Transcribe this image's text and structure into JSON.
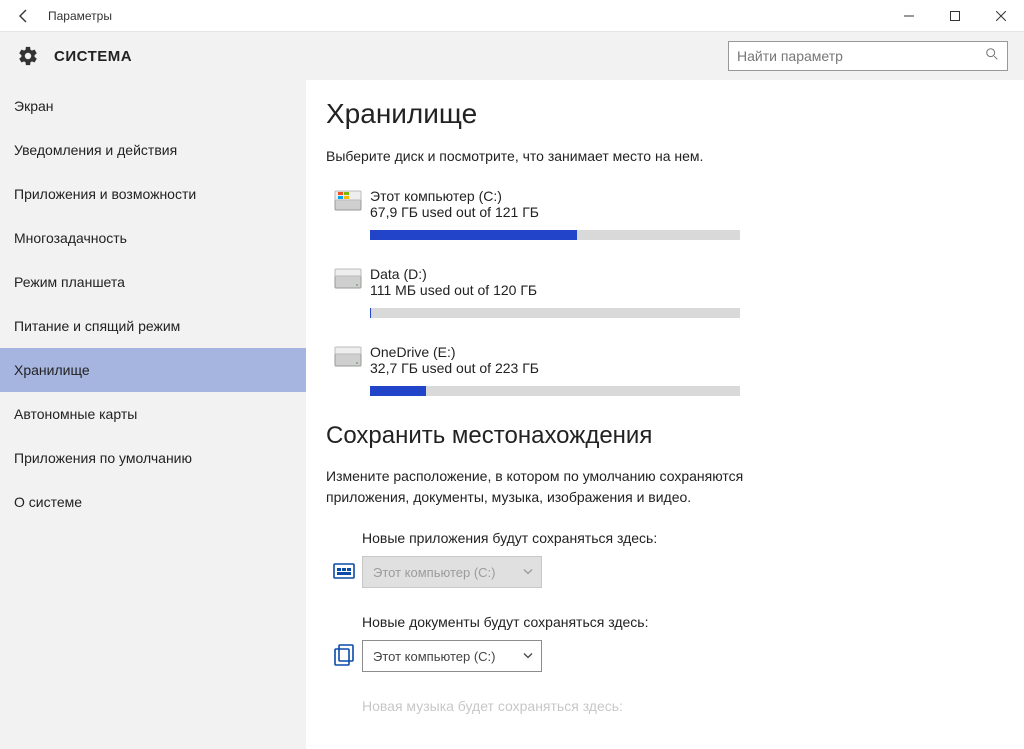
{
  "window": {
    "title": "Параметры"
  },
  "header": {
    "section": "СИСТЕМА",
    "search_placeholder": "Найти параметр"
  },
  "sidebar": {
    "items": [
      {
        "label": "Экран"
      },
      {
        "label": "Уведомления и действия"
      },
      {
        "label": "Приложения и возможности"
      },
      {
        "label": "Многозадачность"
      },
      {
        "label": "Режим планшета"
      },
      {
        "label": "Питание и спящий режим"
      },
      {
        "label": "Хранилище",
        "active": true
      },
      {
        "label": "Автономные карты"
      },
      {
        "label": "Приложения по умолчанию"
      },
      {
        "label": "О системе"
      }
    ]
  },
  "storage": {
    "heading": "Хранилище",
    "description": "Выберите диск и посмотрите, что занимает место на нем.",
    "drives": [
      {
        "name": "Этот компьютер (C:)",
        "usage_text": "67,9 ГБ used out of 121 ГБ",
        "percent": 56,
        "kind": "system"
      },
      {
        "name": "Data (D:)",
        "usage_text": "111 МБ used out of 120 ГБ",
        "percent": 0.2,
        "kind": "hdd"
      },
      {
        "name": "OneDrive (E:)",
        "usage_text": "32,7 ГБ used out of 223 ГБ",
        "percent": 15,
        "kind": "hdd"
      }
    ]
  },
  "save_locations": {
    "heading": "Сохранить местонахождения",
    "description": "Измените расположение, в котором по умолчанию сохраняются приложения, документы, музыка, изображения и видео.",
    "rows": [
      {
        "label": "Новые приложения будут сохраняться здесь:",
        "value": "Этот компьютер (C:)",
        "disabled": true,
        "icon": "apps"
      },
      {
        "label": "Новые документы будут сохраняться здесь:",
        "value": "Этот компьютер (C:)",
        "disabled": false,
        "icon": "docs"
      }
    ],
    "truncated_next_label": "Новая музыка будет сохраняться здесь:"
  }
}
